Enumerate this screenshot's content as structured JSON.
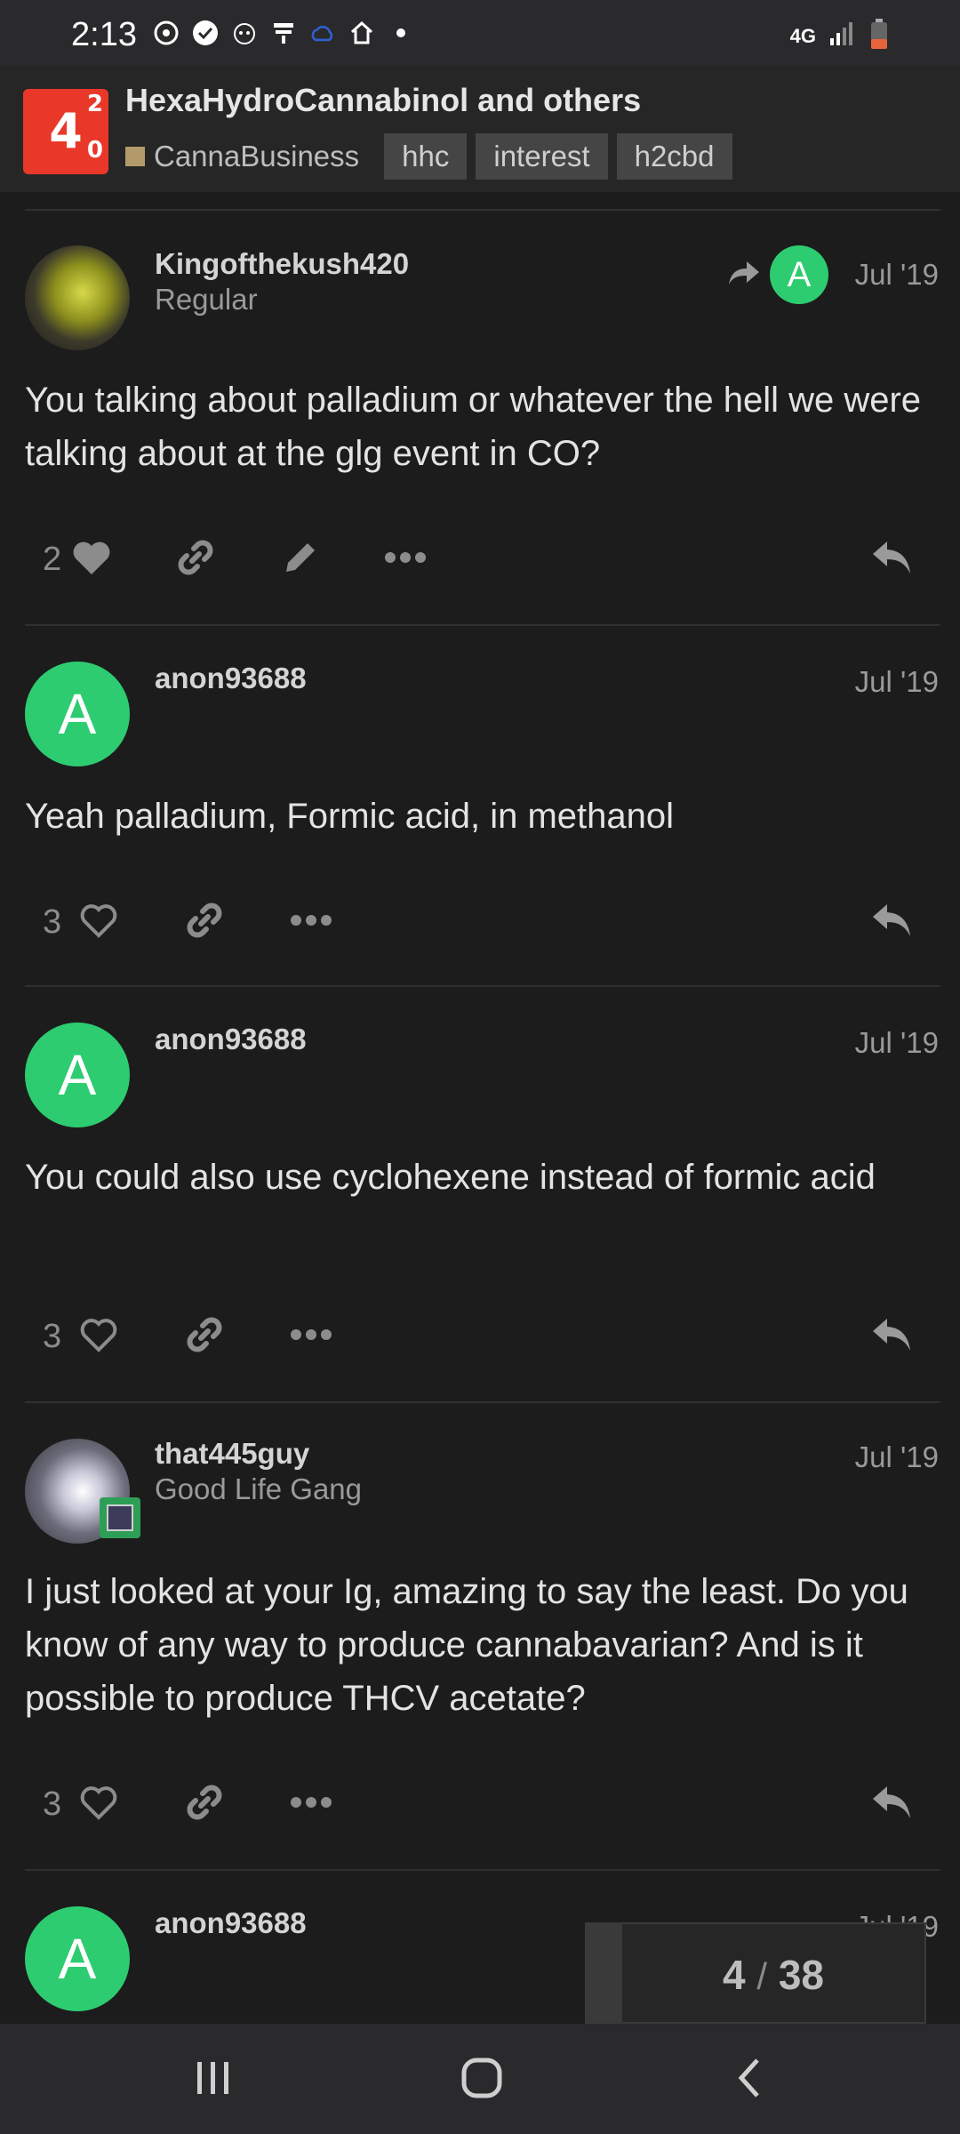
{
  "status_bar": {
    "time": "2:13",
    "network": "4G",
    "icons": [
      "threads-icon",
      "verified-icon",
      "robot-icon",
      "news-icon",
      "cloud-icon",
      "home-icon",
      "dot-icon"
    ]
  },
  "header": {
    "title": "HexaHydroCannabinol and others",
    "category": "CannaBusiness",
    "category_color": "#b39a6b",
    "tags": [
      "hhc",
      "interest",
      "h2cbd"
    ]
  },
  "posts": [
    {
      "username": "Kingofthekush420",
      "user_title": "Regular",
      "date": "Jul '19",
      "reply_to_avatar_letter": "A",
      "body": "You talking about palladium or whatever the hell we were talking about at the glg event in CO?",
      "likes": "2"
    },
    {
      "username": "anon93688",
      "avatar_letter": "A",
      "date": "Jul '19",
      "body": "Yeah palladium, Formic acid, in methanol",
      "likes": "3"
    },
    {
      "username": "anon93688",
      "avatar_letter": "A",
      "date": "Jul '19",
      "body": "You could also use cyclohexene instead of formic acid",
      "likes": "3"
    },
    {
      "username": "that445guy",
      "user_title": "Good Life Gang",
      "date": "Jul '19",
      "body": "I just looked at your Ig, amazing to say the least. Do you know of any way to produce cannabavarian? And is it possible to produce THCV acetate?",
      "likes": "3"
    },
    {
      "username": "anon93688",
      "avatar_letter": "A",
      "date": "Jul '19"
    }
  ],
  "progress": {
    "current": "4",
    "separator": "/",
    "total": "38"
  },
  "colors": {
    "background": "#1c1c1c",
    "avatar_green": "#2ecc71",
    "logo_red": "#e9382a"
  }
}
